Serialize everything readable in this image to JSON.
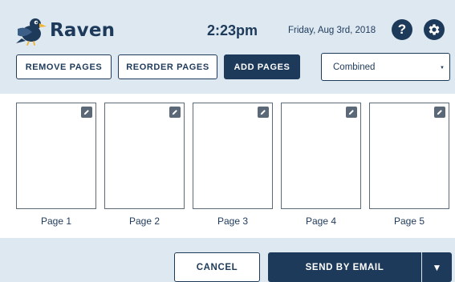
{
  "header": {
    "brand": "Raven",
    "time": "2:23pm",
    "date": "Friday, Aug 3rd, 2018",
    "help_glyph": "?"
  },
  "toolbar": {
    "remove_label": "REMOVE PAGES",
    "reorder_label": "REORDER PAGES",
    "add_label": "ADD PAGES",
    "mode_selected": "Combined"
  },
  "pages": [
    {
      "label": "Page 1"
    },
    {
      "label": "Page 2"
    },
    {
      "label": "Page 3"
    },
    {
      "label": "Page 4"
    },
    {
      "label": "Page 5"
    }
  ],
  "footer": {
    "cancel_label": "CANCEL",
    "send_label": "SEND BY EMAIL"
  },
  "icons": {
    "logo": "raven-bird-icon",
    "help": "help-icon",
    "settings": "gear-icon",
    "edit": "pencil-icon",
    "dropdown": "triangle-down-icon"
  },
  "colors": {
    "navy": "#1e3a5a",
    "header_bg": "#dde8f1",
    "edit_badge": "#5b6877"
  }
}
